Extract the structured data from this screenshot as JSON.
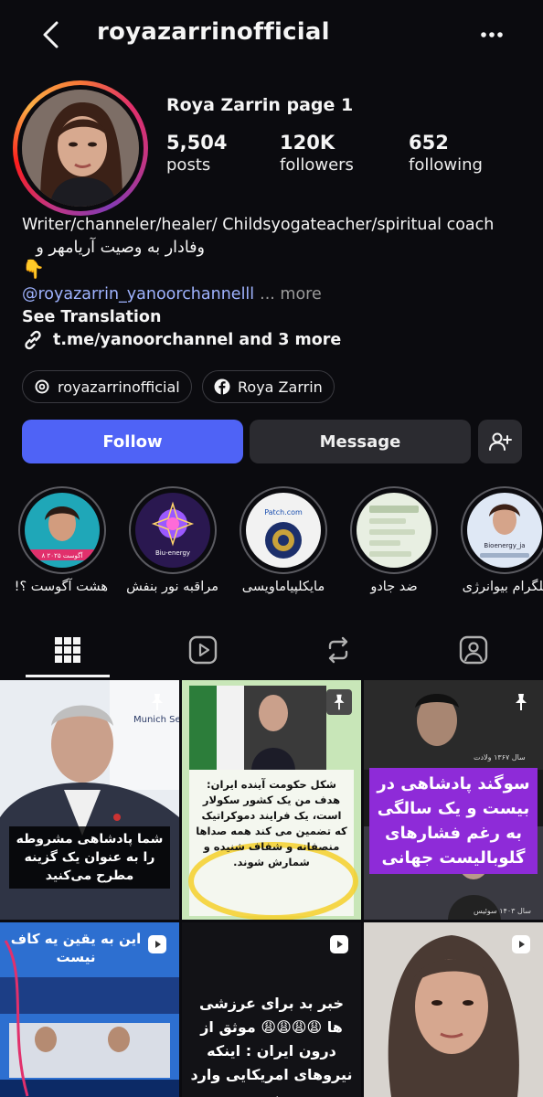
{
  "header": {
    "username": "royazarrinofficial"
  },
  "profile": {
    "display_name": "Roya Zarrin page 1",
    "stats": [
      {
        "value": "5,504",
        "label": "posts"
      },
      {
        "value": "120K",
        "label": "followers"
      },
      {
        "value": "652",
        "label": "following"
      }
    ],
    "bio_line1": "Writer/channeler/healer/ Childsyogateacher/spiritual coach",
    "bio_line2": "وفادار به وصیت  آریامهر  و",
    "bio_emoji": "👇",
    "mention": "@royazarrin_yanoorchannelll",
    "more_label": "... more",
    "see_translation": "See Translation",
    "link_text": "t.me/yanoorchannel and 3 more"
  },
  "chips": {
    "threads": "royazarrinofficial",
    "facebook": "Roya Zarrin"
  },
  "actions": {
    "follow": "Follow",
    "message": "Message"
  },
  "highlights": [
    {
      "label": "هشت آگوست ؟!",
      "thumb_text": "۸ آگوست ۲۰۲۵"
    },
    {
      "label": "مراقبه نور بنفش",
      "thumb_text": "Biu-energy"
    },
    {
      "label": "مایکلپیاماویسی",
      "thumb_text": "Patch.com"
    },
    {
      "label": "ضد جادو",
      "thumb_text": ""
    },
    {
      "label": "تلگرام بیوانرژی",
      "thumb_text": "Bioenergy_ja"
    }
  ],
  "posts": [
    {
      "caption": "شما پادشاهی مشروطه را به عنوان یک گزینه مطرح می‌کنید",
      "overlay_text": "Munich Se Conferenc",
      "pinned": true
    },
    {
      "caption": "شکل حکومت آینده ایران: هدف من یک کشور سکولار است، یک فرایند دموکراتیک که تضمین می کند همه صداها منصفانه و شفاف شنیده و شمارش شوند.",
      "pinned": true
    },
    {
      "caption": "سوگند پادشاهی در بیست و یک سالگی به رغم فشارهای گلوبالیست جهانی",
      "overlay_text_top": "سال ۱۳۶۷ ولادت",
      "overlay_text_bottom": "سال ۱۴۰۳ سوئیس",
      "pinned": true
    },
    {
      "caption": "این به یقین یه کاف نیست",
      "reel": true
    },
    {
      "caption": "خبر بد برای عرزشی ها 😩😩😩😩 موثق از درون ایران : اینکه نیروهای امریکایی وارد بندر",
      "reel": true
    },
    {
      "caption": "",
      "reel": true
    }
  ],
  "colors": {
    "background": "#0b0b0f",
    "follow_button": "#4f63f6",
    "secondary_button": "#2b2b30",
    "mention_link": "#9fb3ff",
    "caption_purple": "#8e2bd8"
  }
}
